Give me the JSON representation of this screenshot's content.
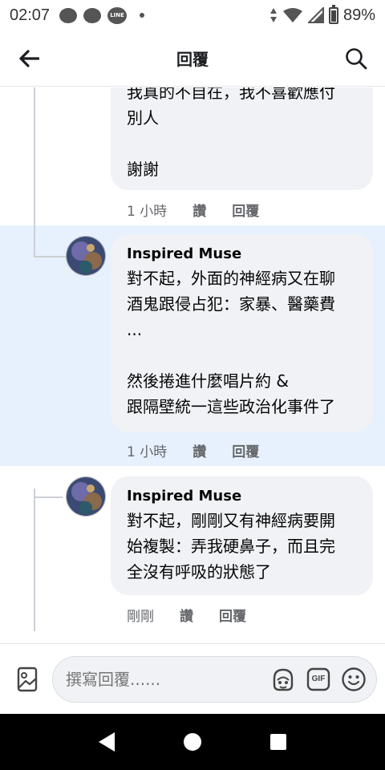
{
  "status_bar": {
    "time": "02:07",
    "line_badge": "LINE",
    "battery": "89%"
  },
  "header": {
    "title": "回覆"
  },
  "comments": [
    {
      "text": "我真的不自在，我不喜歡應付\n別人\n\n謝謝",
      "time": "1 小時",
      "like": "讚",
      "reply": "回覆"
    },
    {
      "author": "Inspired Muse",
      "text": "對不起，外面的神經病又在聊\n酒鬼跟侵占犯：家暴、醫藥費\n...\n\n然後捲進什麼唱片約 &\n跟隔壁統一這些政治化事件了",
      "time": "1 小時",
      "like": "讚",
      "reply": "回覆"
    },
    {
      "author": "Inspired Muse",
      "text": "對不起，剛剛又有神經病要開\n始複製：弄我硬鼻子，而且完\n全沒有呼吸的狀態了",
      "time": "剛剛",
      "like": "讚",
      "reply": "回覆"
    }
  ],
  "composer": {
    "placeholder": "撰寫回覆......",
    "gif_label": "GIF"
  },
  "colors": {
    "highlight": "#e7f0fd",
    "bubble": "#f0f2f5",
    "meta": "#65676b"
  }
}
